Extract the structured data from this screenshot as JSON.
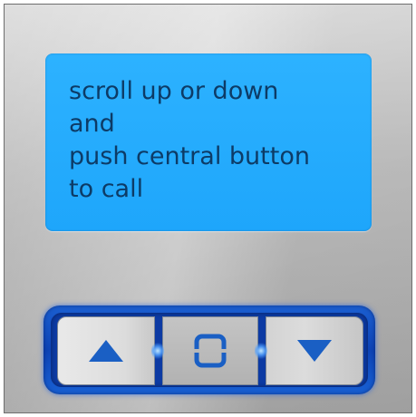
{
  "display": {
    "lines": [
      "scroll up or down",
      "and",
      "push central button",
      "to call"
    ]
  },
  "keypad": {
    "buttons": [
      {
        "name": "up",
        "icon": "triangle-up-icon"
      },
      {
        "name": "call",
        "icon": "rounded-square-icon"
      },
      {
        "name": "down",
        "icon": "triangle-down-icon"
      }
    ]
  },
  "colors": {
    "display_background": "#22aaff",
    "display_text": "#0d3b66",
    "keypad_frame": "#0d43b5",
    "icon_blue": "#1a5fc4",
    "panel_metal": "#bcbcbc"
  }
}
